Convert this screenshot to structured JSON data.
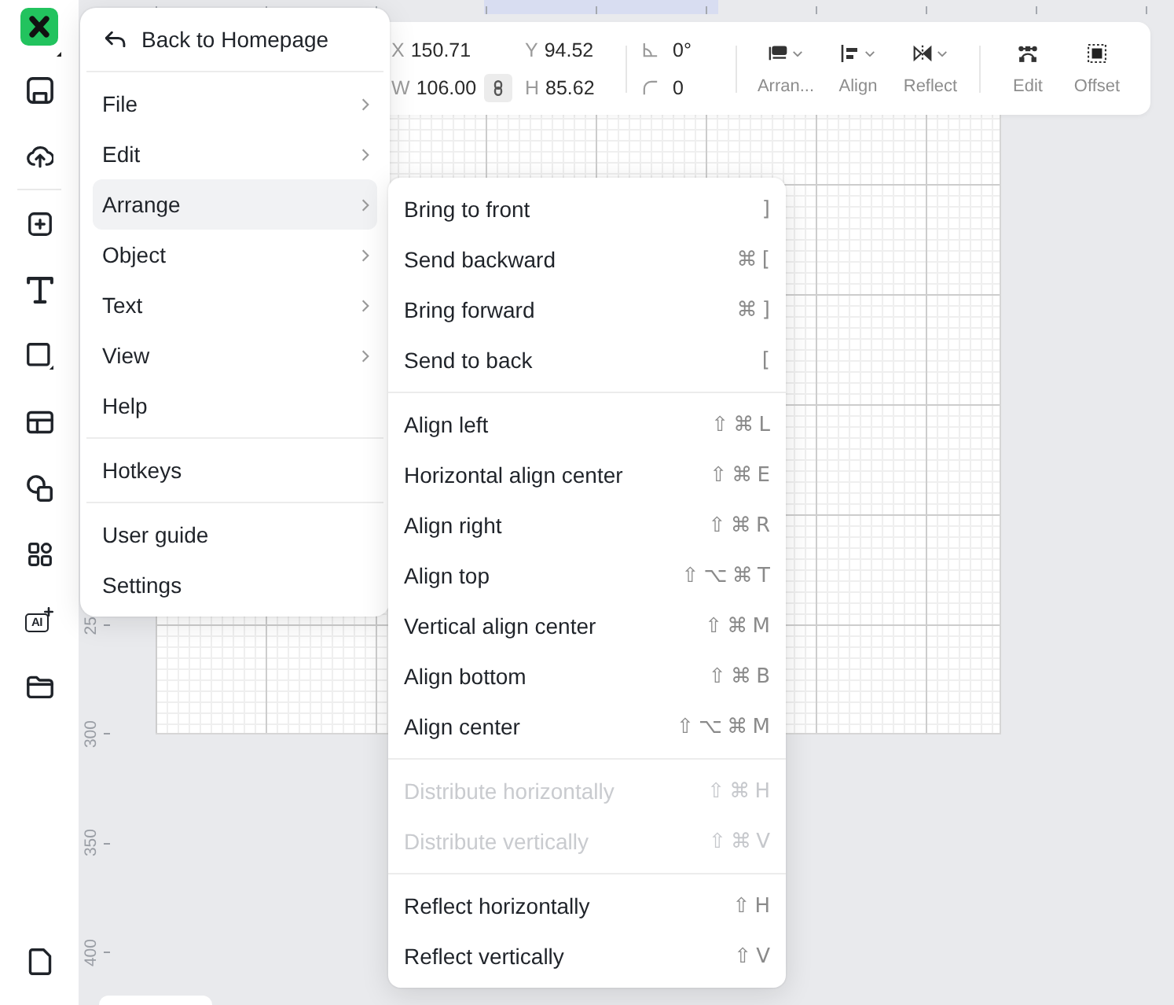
{
  "sidebar": {
    "ai_label": "AI"
  },
  "vertical_ruler": {
    "labels": [
      "25",
      "300",
      "350",
      "400"
    ]
  },
  "toolbar": {
    "fields": [
      {
        "label": "X",
        "value": "150.71"
      },
      {
        "label": "Y",
        "value": "94.52"
      },
      {
        "label": "W",
        "value": "106.00"
      },
      {
        "label": "H",
        "value": "85.62"
      }
    ],
    "aspect_locked": true,
    "rotation": "0°",
    "corner_radius": "0",
    "action_groups": [
      {
        "actions": [
          {
            "kind": "arrange",
            "label": "Arran...",
            "dropdown": true
          },
          {
            "kind": "align",
            "label": "Align",
            "dropdown": true
          },
          {
            "kind": "reflect",
            "label": "Reflect",
            "dropdown": true
          }
        ]
      },
      {
        "actions": [
          {
            "kind": "edit",
            "label": "Edit",
            "dropdown": false
          },
          {
            "kind": "offset",
            "label": "Offset",
            "dropdown": false
          }
        ]
      }
    ]
  },
  "main_menu": {
    "back_label": "Back to Homepage",
    "sections": [
      {
        "items": [
          {
            "label": "File",
            "submenu": true,
            "selected": false
          },
          {
            "label": "Edit",
            "submenu": true,
            "selected": false
          },
          {
            "label": "Arrange",
            "submenu": true,
            "selected": true
          },
          {
            "label": "Object",
            "submenu": true,
            "selected": false
          },
          {
            "label": "Text",
            "submenu": true,
            "selected": false
          },
          {
            "label": "View",
            "submenu": true,
            "selected": false
          },
          {
            "label": "Help",
            "submenu": false,
            "selected": false
          }
        ]
      },
      {
        "items": [
          {
            "label": "Hotkeys",
            "submenu": false,
            "selected": false
          }
        ]
      },
      {
        "items": [
          {
            "label": "User guide",
            "submenu": false,
            "selected": false
          },
          {
            "label": "Settings",
            "submenu": false,
            "selected": false
          }
        ]
      }
    ]
  },
  "arrange_submenu": {
    "sections": [
      {
        "items": [
          {
            "label": "Bring to front",
            "shortcut": "]",
            "disabled": false
          },
          {
            "label": "Send backward",
            "shortcut": "⌘ [",
            "disabled": false
          },
          {
            "label": "Bring forward",
            "shortcut": "⌘ ]",
            "disabled": false
          },
          {
            "label": "Send to back",
            "shortcut": "[",
            "disabled": false
          }
        ]
      },
      {
        "items": [
          {
            "label": "Align left",
            "shortcut": "⇧ ⌘ L",
            "disabled": false
          },
          {
            "label": "Horizontal align center",
            "shortcut": "⇧ ⌘ E",
            "disabled": false
          },
          {
            "label": "Align right",
            "shortcut": "⇧ ⌘ R",
            "disabled": false
          },
          {
            "label": "Align top",
            "shortcut": "⇧ ⌥ ⌘ T",
            "disabled": false
          },
          {
            "label": "Vertical align center",
            "shortcut": "⇧ ⌘ M",
            "disabled": false
          },
          {
            "label": "Align bottom",
            "shortcut": "⇧ ⌘ B",
            "disabled": false
          },
          {
            "label": "Align center",
            "shortcut": "⇧ ⌥ ⌘ M",
            "disabled": false
          }
        ]
      },
      {
        "items": [
          {
            "label": "Distribute horizontally",
            "shortcut": "⇧ ⌘ H",
            "disabled": true
          },
          {
            "label": "Distribute vertically",
            "shortcut": "⇧ ⌘ V",
            "disabled": true
          }
        ]
      },
      {
        "items": [
          {
            "label": "Reflect horizontally",
            "shortcut": "⇧ H",
            "disabled": false
          },
          {
            "label": "Reflect vertically",
            "shortcut": "⇧ V",
            "disabled": false
          }
        ]
      }
    ]
  }
}
